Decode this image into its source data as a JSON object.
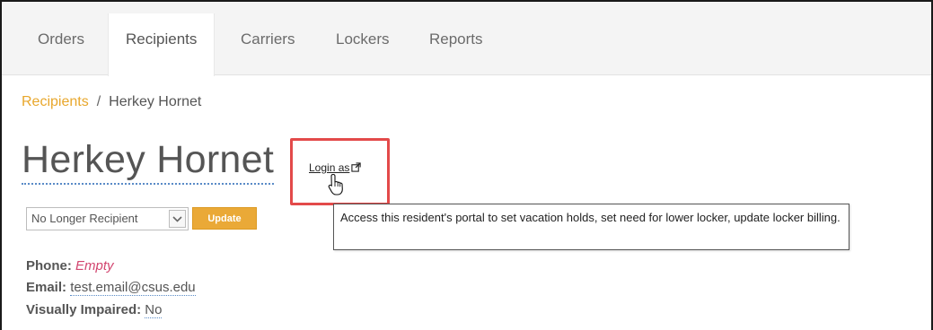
{
  "nav": {
    "tabs": [
      {
        "label": "Orders"
      },
      {
        "label": "Recipients"
      },
      {
        "label": "Carriers"
      },
      {
        "label": "Lockers"
      },
      {
        "label": "Reports"
      }
    ],
    "active_tab": "Recipients"
  },
  "breadcrumb": {
    "parent": "Recipients",
    "separator": "/",
    "current": "Herkey Hornet"
  },
  "recipient": {
    "name": "Herkey Hornet",
    "login_as_label": "Login as",
    "status_select_value": "No Longer Recipient",
    "update_label": "Update",
    "tooltip": "Access this resident's portal to set vacation holds, set need for lower locker, update locker billing.",
    "phone_label": "Phone:",
    "phone_value": "Empty",
    "email_label": "Email:",
    "email_value": "test.email@csus.edu",
    "visually_impaired_label": "Visually Impaired:",
    "visually_impaired_value": "No"
  },
  "colors": {
    "accent": "#eaa937",
    "breadcrumb_link": "#e8a72c",
    "highlight": "#e34a4a",
    "empty_value": "#d2456f"
  }
}
